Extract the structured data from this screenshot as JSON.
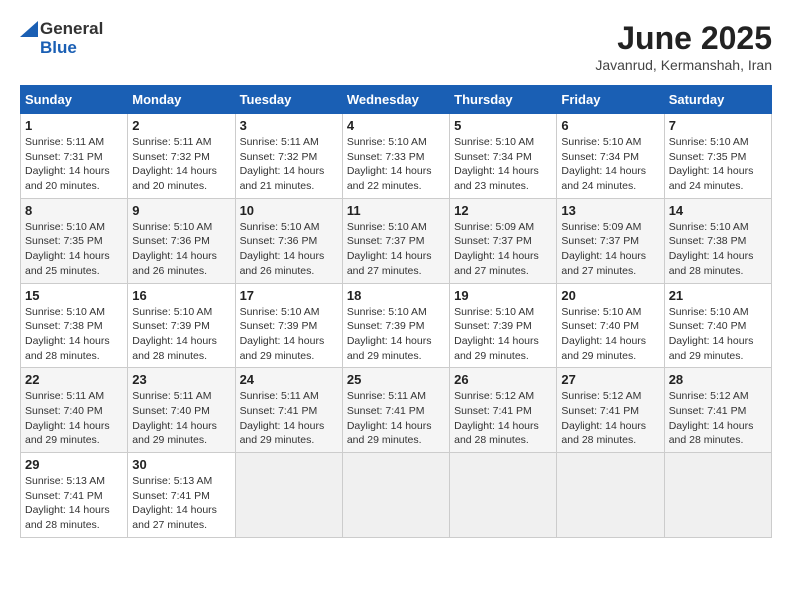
{
  "header": {
    "logo_general": "General",
    "logo_blue": "Blue",
    "month_year": "June 2025",
    "location": "Javanrud, Kermanshah, Iran"
  },
  "weekdays": [
    "Sunday",
    "Monday",
    "Tuesday",
    "Wednesday",
    "Thursday",
    "Friday",
    "Saturday"
  ],
  "weeks": [
    [
      {
        "day": "1",
        "sunrise": "Sunrise: 5:11 AM",
        "sunset": "Sunset: 7:31 PM",
        "daylight": "Daylight: 14 hours and 20 minutes."
      },
      {
        "day": "2",
        "sunrise": "Sunrise: 5:11 AM",
        "sunset": "Sunset: 7:32 PM",
        "daylight": "Daylight: 14 hours and 20 minutes."
      },
      {
        "day": "3",
        "sunrise": "Sunrise: 5:11 AM",
        "sunset": "Sunset: 7:32 PM",
        "daylight": "Daylight: 14 hours and 21 minutes."
      },
      {
        "day": "4",
        "sunrise": "Sunrise: 5:10 AM",
        "sunset": "Sunset: 7:33 PM",
        "daylight": "Daylight: 14 hours and 22 minutes."
      },
      {
        "day": "5",
        "sunrise": "Sunrise: 5:10 AM",
        "sunset": "Sunset: 7:34 PM",
        "daylight": "Daylight: 14 hours and 23 minutes."
      },
      {
        "day": "6",
        "sunrise": "Sunrise: 5:10 AM",
        "sunset": "Sunset: 7:34 PM",
        "daylight": "Daylight: 14 hours and 24 minutes."
      },
      {
        "day": "7",
        "sunrise": "Sunrise: 5:10 AM",
        "sunset": "Sunset: 7:35 PM",
        "daylight": "Daylight: 14 hours and 24 minutes."
      }
    ],
    [
      {
        "day": "8",
        "sunrise": "Sunrise: 5:10 AM",
        "sunset": "Sunset: 7:35 PM",
        "daylight": "Daylight: 14 hours and 25 minutes."
      },
      {
        "day": "9",
        "sunrise": "Sunrise: 5:10 AM",
        "sunset": "Sunset: 7:36 PM",
        "daylight": "Daylight: 14 hours and 26 minutes."
      },
      {
        "day": "10",
        "sunrise": "Sunrise: 5:10 AM",
        "sunset": "Sunset: 7:36 PM",
        "daylight": "Daylight: 14 hours and 26 minutes."
      },
      {
        "day": "11",
        "sunrise": "Sunrise: 5:10 AM",
        "sunset": "Sunset: 7:37 PM",
        "daylight": "Daylight: 14 hours and 27 minutes."
      },
      {
        "day": "12",
        "sunrise": "Sunrise: 5:09 AM",
        "sunset": "Sunset: 7:37 PM",
        "daylight": "Daylight: 14 hours and 27 minutes."
      },
      {
        "day": "13",
        "sunrise": "Sunrise: 5:09 AM",
        "sunset": "Sunset: 7:37 PM",
        "daylight": "Daylight: 14 hours and 27 minutes."
      },
      {
        "day": "14",
        "sunrise": "Sunrise: 5:10 AM",
        "sunset": "Sunset: 7:38 PM",
        "daylight": "Daylight: 14 hours and 28 minutes."
      }
    ],
    [
      {
        "day": "15",
        "sunrise": "Sunrise: 5:10 AM",
        "sunset": "Sunset: 7:38 PM",
        "daylight": "Daylight: 14 hours and 28 minutes."
      },
      {
        "day": "16",
        "sunrise": "Sunrise: 5:10 AM",
        "sunset": "Sunset: 7:39 PM",
        "daylight": "Daylight: 14 hours and 28 minutes."
      },
      {
        "day": "17",
        "sunrise": "Sunrise: 5:10 AM",
        "sunset": "Sunset: 7:39 PM",
        "daylight": "Daylight: 14 hours and 29 minutes."
      },
      {
        "day": "18",
        "sunrise": "Sunrise: 5:10 AM",
        "sunset": "Sunset: 7:39 PM",
        "daylight": "Daylight: 14 hours and 29 minutes."
      },
      {
        "day": "19",
        "sunrise": "Sunrise: 5:10 AM",
        "sunset": "Sunset: 7:39 PM",
        "daylight": "Daylight: 14 hours and 29 minutes."
      },
      {
        "day": "20",
        "sunrise": "Sunrise: 5:10 AM",
        "sunset": "Sunset: 7:40 PM",
        "daylight": "Daylight: 14 hours and 29 minutes."
      },
      {
        "day": "21",
        "sunrise": "Sunrise: 5:10 AM",
        "sunset": "Sunset: 7:40 PM",
        "daylight": "Daylight: 14 hours and 29 minutes."
      }
    ],
    [
      {
        "day": "22",
        "sunrise": "Sunrise: 5:11 AM",
        "sunset": "Sunset: 7:40 PM",
        "daylight": "Daylight: 14 hours and 29 minutes."
      },
      {
        "day": "23",
        "sunrise": "Sunrise: 5:11 AM",
        "sunset": "Sunset: 7:40 PM",
        "daylight": "Daylight: 14 hours and 29 minutes."
      },
      {
        "day": "24",
        "sunrise": "Sunrise: 5:11 AM",
        "sunset": "Sunset: 7:41 PM",
        "daylight": "Daylight: 14 hours and 29 minutes."
      },
      {
        "day": "25",
        "sunrise": "Sunrise: 5:11 AM",
        "sunset": "Sunset: 7:41 PM",
        "daylight": "Daylight: 14 hours and 29 minutes."
      },
      {
        "day": "26",
        "sunrise": "Sunrise: 5:12 AM",
        "sunset": "Sunset: 7:41 PM",
        "daylight": "Daylight: 14 hours and 28 minutes."
      },
      {
        "day": "27",
        "sunrise": "Sunrise: 5:12 AM",
        "sunset": "Sunset: 7:41 PM",
        "daylight": "Daylight: 14 hours and 28 minutes."
      },
      {
        "day": "28",
        "sunrise": "Sunrise: 5:12 AM",
        "sunset": "Sunset: 7:41 PM",
        "daylight": "Daylight: 14 hours and 28 minutes."
      }
    ],
    [
      {
        "day": "29",
        "sunrise": "Sunrise: 5:13 AM",
        "sunset": "Sunset: 7:41 PM",
        "daylight": "Daylight: 14 hours and 28 minutes."
      },
      {
        "day": "30",
        "sunrise": "Sunrise: 5:13 AM",
        "sunset": "Sunset: 7:41 PM",
        "daylight": "Daylight: 14 hours and 27 minutes."
      },
      null,
      null,
      null,
      null,
      null
    ]
  ]
}
